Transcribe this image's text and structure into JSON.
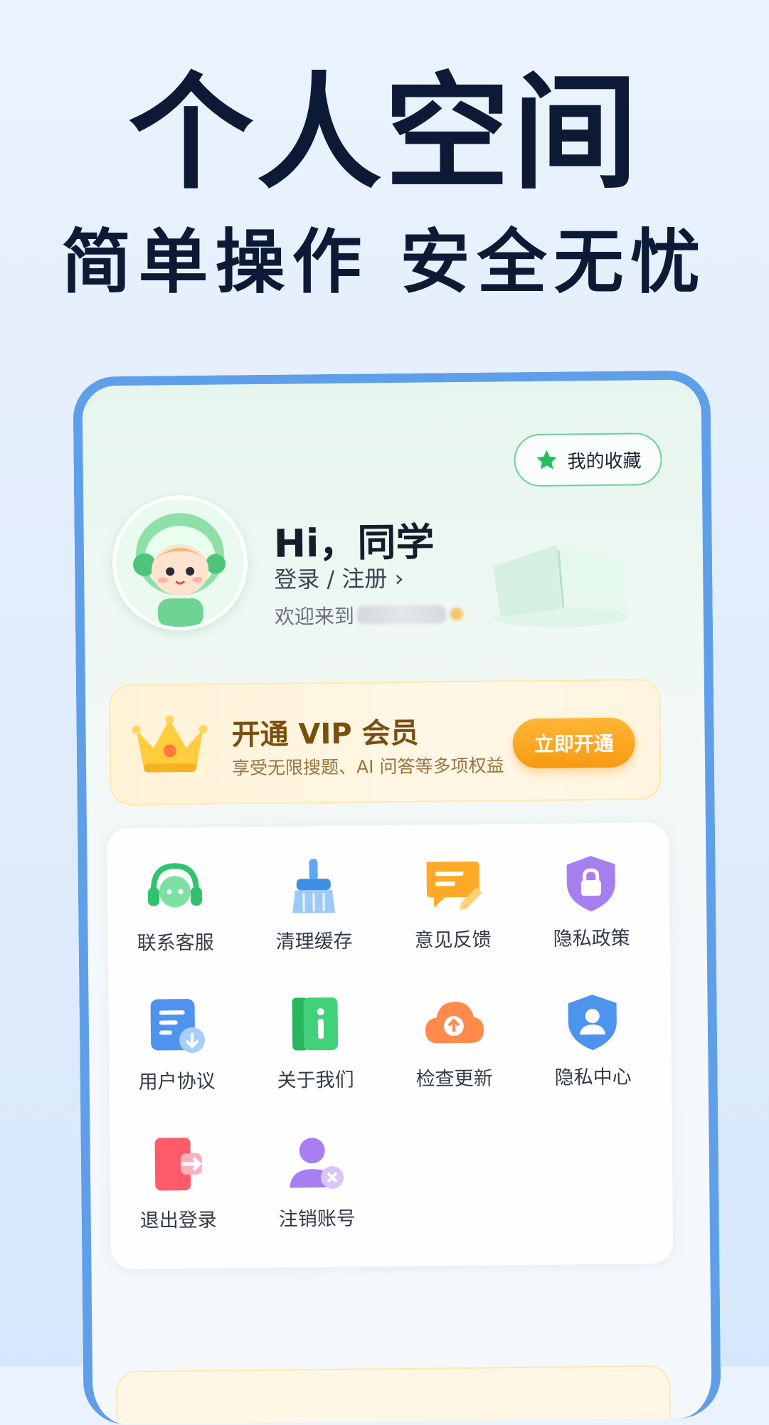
{
  "hero": {
    "title": "个人空间",
    "subtitle": "简单操作 安全无忧"
  },
  "header": {
    "favorites_label": "我的收藏",
    "greeting": "Hi，同学",
    "login_link": "登录 / 注册 ›",
    "welcome_prefix": "欢迎来到"
  },
  "vip": {
    "title": "开通 VIP 会员",
    "subtitle": "享受无限搜题、AI 问答等多项权益",
    "button": "立即开通"
  },
  "menu": {
    "items": [
      {
        "label": "联系客服",
        "icon": "headset-icon"
      },
      {
        "label": "清理缓存",
        "icon": "broom-icon"
      },
      {
        "label": "意见反馈",
        "icon": "feedback-icon"
      },
      {
        "label": "隐私政策",
        "icon": "lock-shield-icon"
      },
      {
        "label": "用户协议",
        "icon": "document-download-icon"
      },
      {
        "label": "关于我们",
        "icon": "info-book-icon"
      },
      {
        "label": "检查更新",
        "icon": "cloud-upload-icon"
      },
      {
        "label": "隐私中心",
        "icon": "user-shield-icon"
      },
      {
        "label": "退出登录",
        "icon": "logout-door-icon"
      },
      {
        "label": "注销账号",
        "icon": "user-remove-icon"
      }
    ]
  },
  "colors": {
    "accent_green": "#2fc46b",
    "vip_orange": "#f7a21b",
    "frame_blue": "#5f9fe9",
    "title_navy": "#0d1a36"
  }
}
